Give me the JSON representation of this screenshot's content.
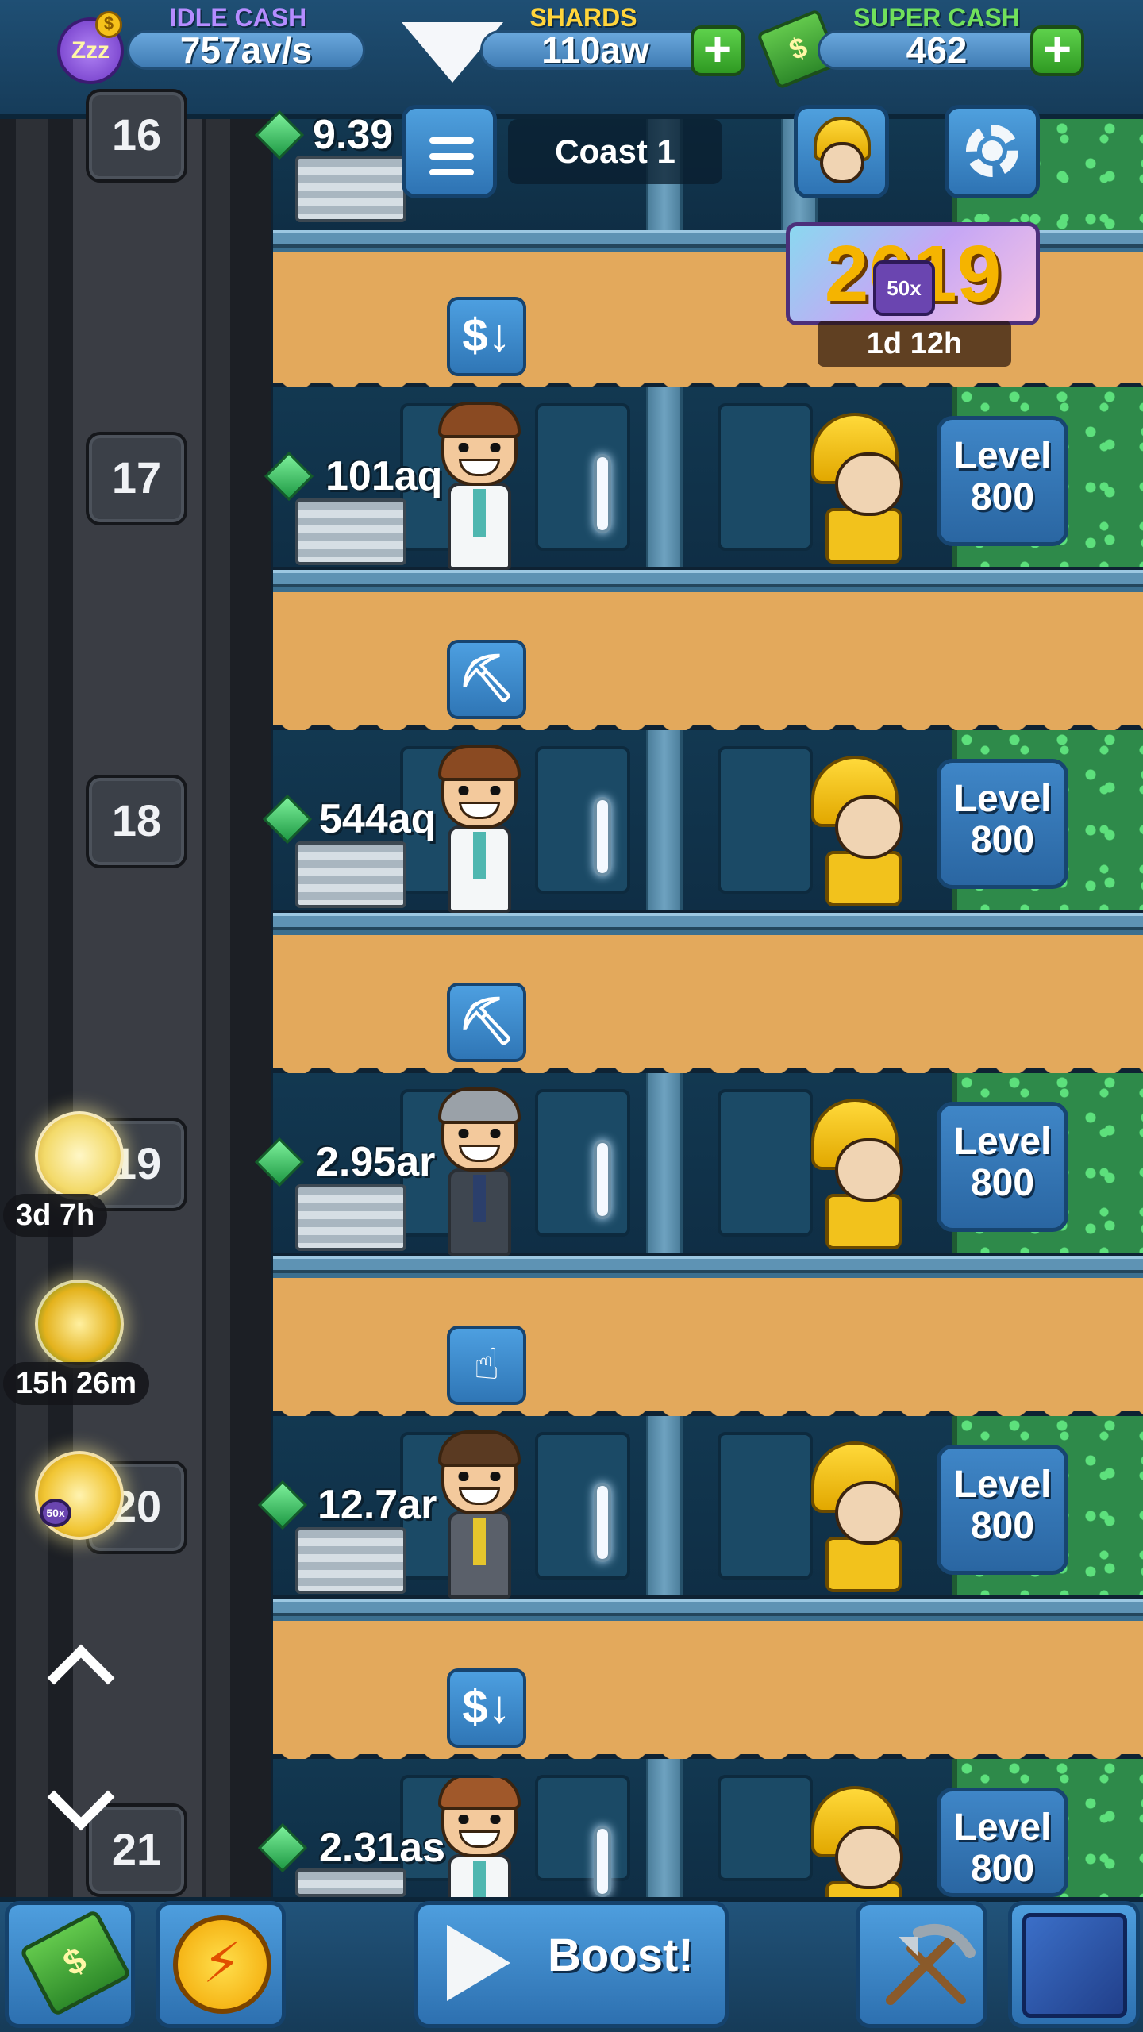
{
  "header": {
    "idle_cash": {
      "title": "IDLE CASH",
      "value": "757av/s",
      "title_color": "#b58cff"
    },
    "shards": {
      "title": "SHARDS",
      "value": "110aw",
      "title_color": "#ffd43a"
    },
    "super_cash": {
      "title": "SUPER CASH",
      "value": "462",
      "title_color": "#71e05b"
    },
    "plus_label": "+"
  },
  "top_controls": {
    "mine_name": "Coast 1"
  },
  "event": {
    "year_text": "2019",
    "multiplier": "50x",
    "timer": "1d 12h"
  },
  "floors": [
    {
      "number": "16",
      "cash": "9.39",
      "action_icon": "cash-down-icon",
      "level": ""
    },
    {
      "number": "17",
      "cash": "101aq",
      "action_icon": "pickaxe-icon",
      "level_word": "Level",
      "level": "800"
    },
    {
      "number": "18",
      "cash": "544aq",
      "action_icon": "pickaxe-icon",
      "level_word": "Level",
      "level": "800"
    },
    {
      "number": "19",
      "cash": "2.95ar",
      "action_icon": "drill-icon",
      "level_word": "Level",
      "level": "800"
    },
    {
      "number": "20",
      "cash": "12.7ar",
      "action_icon": "cash-down-icon",
      "level_word": "Level",
      "level": "800"
    },
    {
      "number": "21",
      "cash": "2.31as",
      "action_icon": "",
      "level_word": "Level",
      "level": "800"
    }
  ],
  "action_glyphs": {
    "cash_down": "$↓",
    "pickaxe": "⛏",
    "drill": "☝"
  },
  "side_boosts": [
    {
      "icon": "blonde-manager-icon",
      "timer": "3d 7h"
    },
    {
      "icon": "christmas-bells-icon",
      "timer": "15h 26m"
    },
    {
      "icon": "gold-manager-icon",
      "badge": "50x"
    }
  ],
  "bottom_bar": {
    "boost_label": "Boost!",
    "cash_glyph": "$",
    "bolt_glyph": "⚡"
  },
  "colors": {
    "dirt": "#e3a95c",
    "panel_blue": "#2f76b6",
    "plus_green": "#3fb52f",
    "crystal_green": "#2e8a4a"
  }
}
